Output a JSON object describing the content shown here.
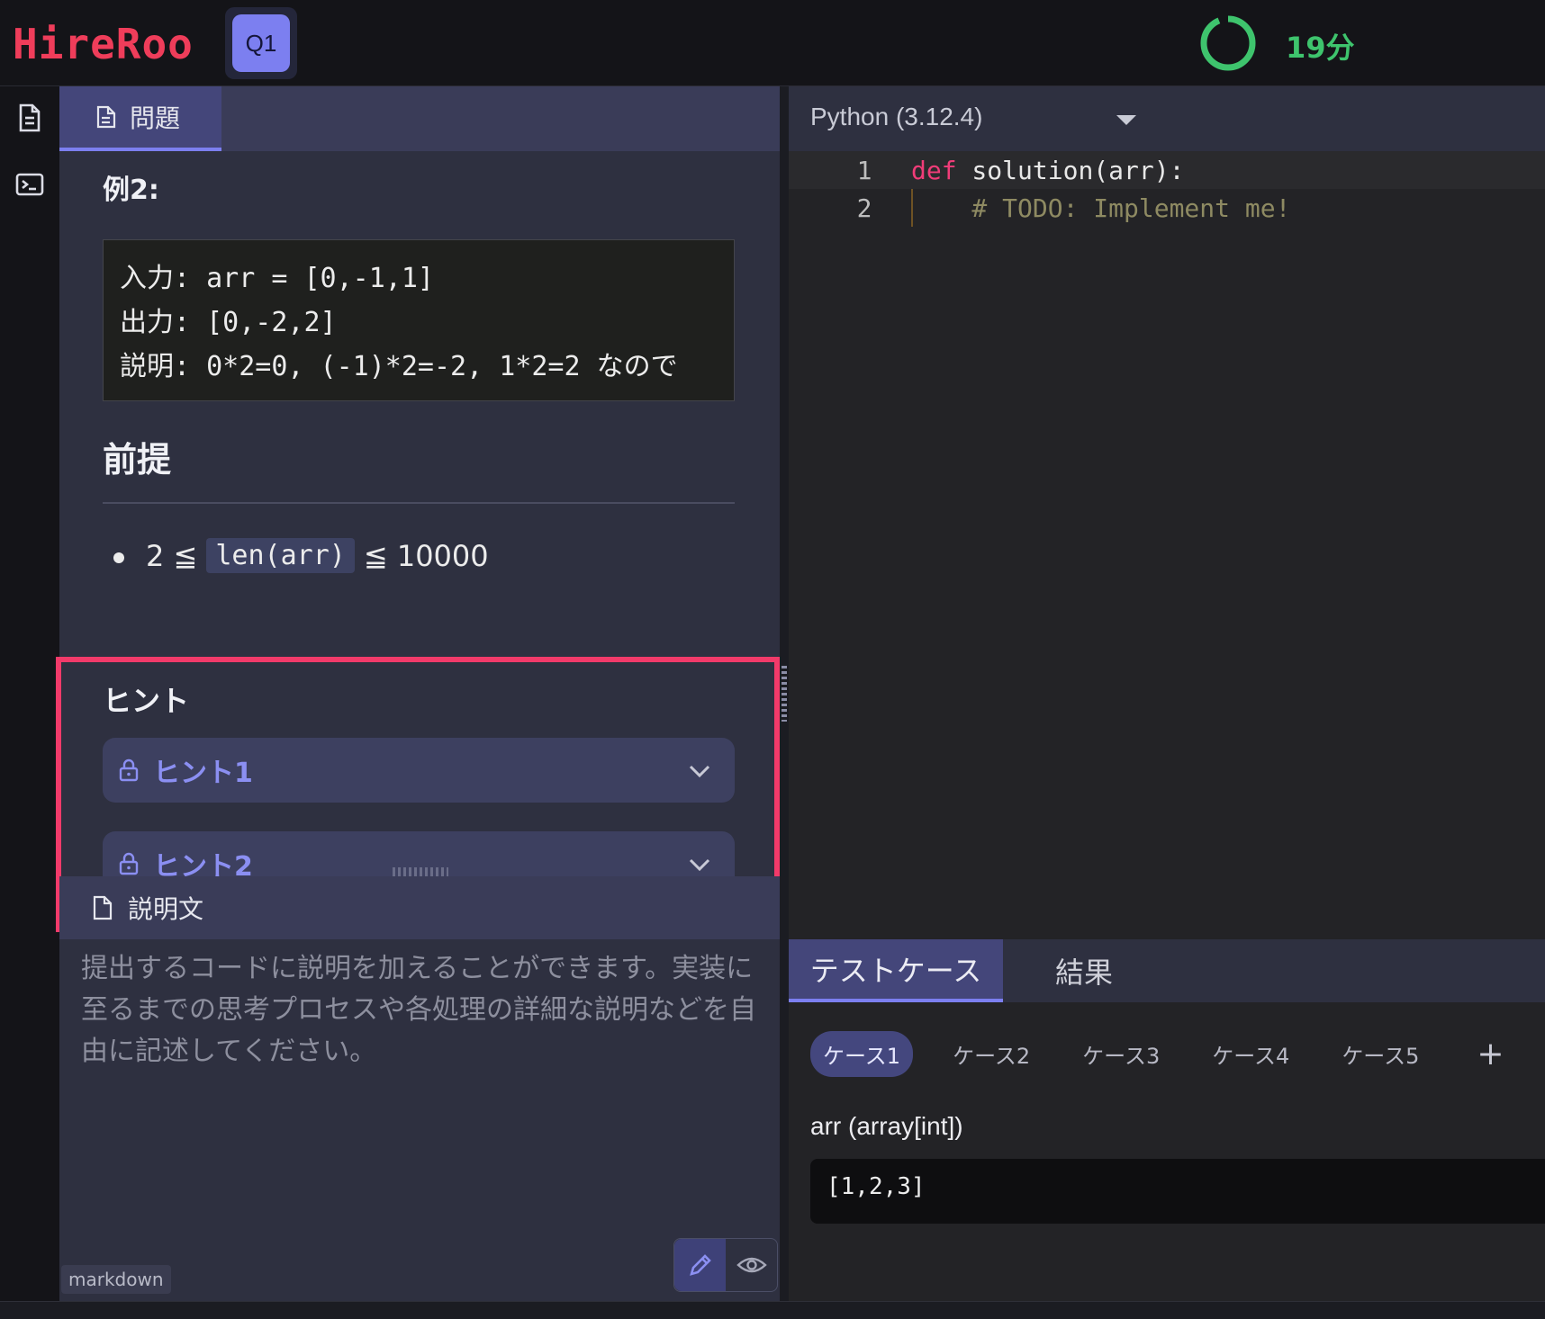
{
  "app": {
    "logo": "HireRoo",
    "question_tab": "Q1"
  },
  "timer": {
    "text": "19分",
    "color": "#3ec46d"
  },
  "left_panel": {
    "tab_label": "問題",
    "example_title": "例2:",
    "example_code": "入力: arr = [0,-1,1]\n出力: [0,-2,2]\n説明: 0*2=0, (-1)*2=-2, 1*2=2 なので",
    "premise_title": "前提",
    "constraint": {
      "left": "2 ≦",
      "code": "len(arr)",
      "right": "≦ 10000"
    },
    "hint_title": "ヒント",
    "hints": [
      {
        "label": "ヒント1"
      },
      {
        "label": "ヒント2"
      }
    ]
  },
  "description": {
    "title": "説明文",
    "placeholder": "提出するコードに説明を加えることができます。実装に至るまでの思考プロセスや各処理の詳細な説明などを自由に記述してください。",
    "format_badge": "markdown"
  },
  "editor": {
    "language": "Python (3.12.4)",
    "lines": [
      {
        "num": "1",
        "kw": "def",
        "rest": " solution(arr):"
      },
      {
        "num": "2",
        "comment": "    # TODO: Implement me!"
      }
    ]
  },
  "test_panel": {
    "tabs": [
      "テストケース",
      "結果"
    ],
    "cases": [
      "ケース1",
      "ケース2",
      "ケース3",
      "ケース4",
      "ケース5"
    ],
    "add_label": "+",
    "arg_name": "arr (array[int])",
    "arg_value": "[1,2,3]"
  },
  "colors": {
    "accent": "#7c7ff0",
    "highlight": "#f23a6a",
    "logo": "#ef3d5a"
  }
}
